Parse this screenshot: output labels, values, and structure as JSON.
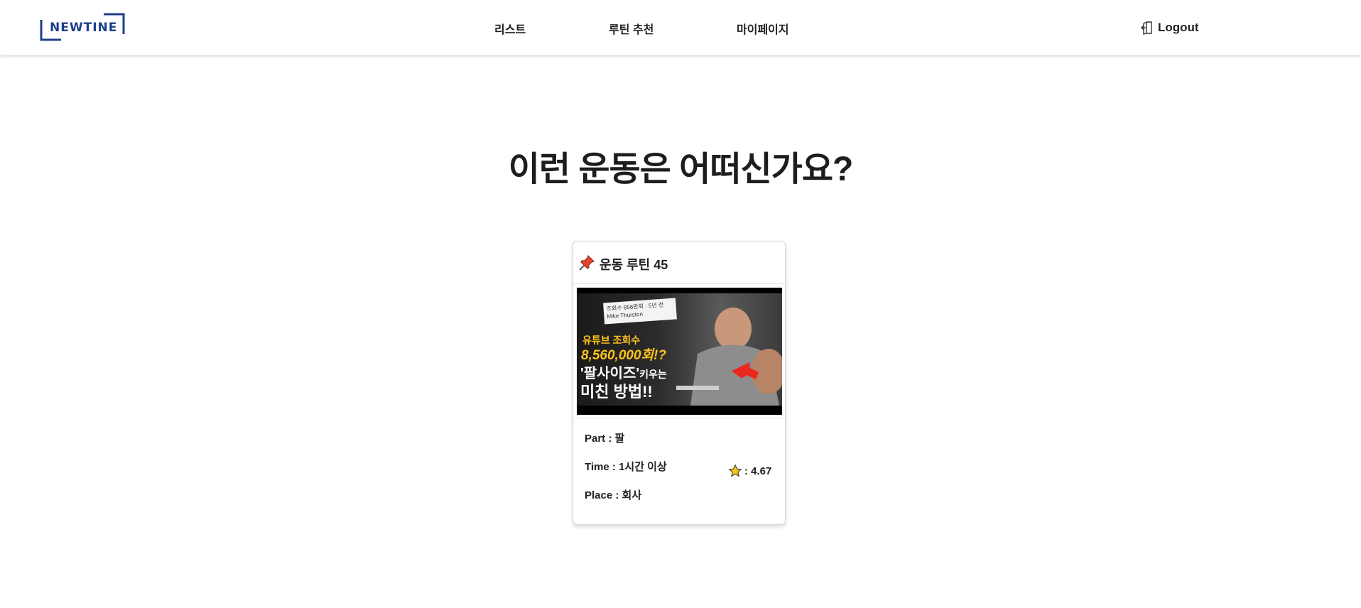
{
  "header": {
    "logo_text": "NEWTINE",
    "nav": {
      "list": "리스트",
      "routine": "루틴 추천",
      "mypage": "마이페이지"
    },
    "logout": "Logout"
  },
  "main": {
    "title": "이런 운동은 어떠신가요?"
  },
  "card": {
    "pin_icon": "pushpin-icon",
    "title": "운동 루틴 45",
    "thumbnail": {
      "badge_line1": "조회수 856만회 · 5년 전",
      "badge_line2": "Mike Thurston",
      "line1": "유튜브 조회수",
      "line2": "8,560,000회!?",
      "line3_main": "'팔사이즈'",
      "line3_small": "키우는",
      "line4": "미친 방법!!"
    },
    "part": "Part : 팔",
    "time": "Time : 1시간 이상",
    "place": "Place : 회사",
    "rating": ": 4.67"
  },
  "colors": {
    "brand": "#1c3f8a",
    "star": "#f5c518"
  }
}
